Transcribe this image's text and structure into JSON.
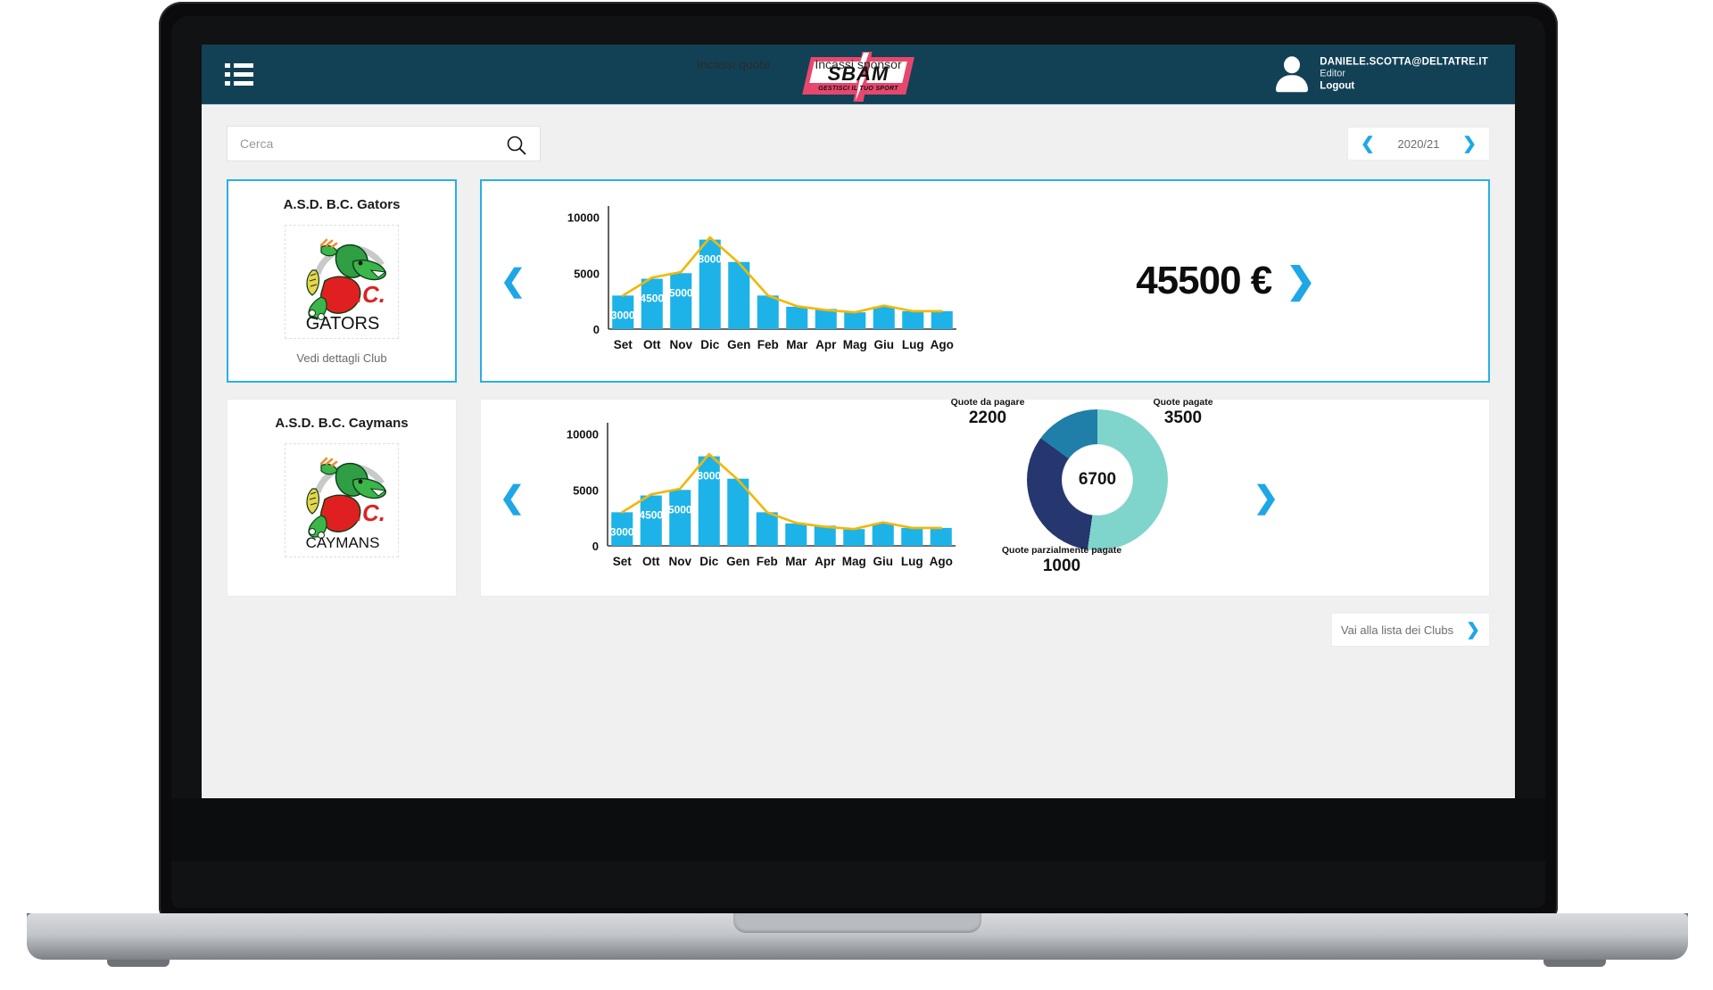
{
  "header": {
    "menu_icon": "hamburger-list-icon",
    "brand": {
      "name": "SBAM",
      "tagline": "GESTISCI IL TUO SPORT"
    },
    "user": {
      "email": "DANIELE.SCOTTA@DELTATRE.IT",
      "role": "Editor",
      "logout": "Logout",
      "avatar_icon": "user-avatar-icon"
    }
  },
  "toolbar": {
    "search_placeholder": "Cerca",
    "search_value": "",
    "search_icon": "search-icon",
    "season": "2020/21",
    "prev_icon": "chevron-left-icon",
    "next_icon": "chevron-right-icon"
  },
  "clubs": [
    {
      "name": "A.S.D. B.C. Gators",
      "link": "Vedi dettagli Club",
      "logo_text": "GATORS",
      "selected": true
    },
    {
      "name": "A.S.D. B.C. Caymans",
      "link": "",
      "logo_text": "CAYMANS",
      "selected": false
    }
  ],
  "sponsor_panel": {
    "title": "Incassi sponsor",
    "total": "45500 €",
    "prev_icon": "chevron-left-icon",
    "next_icon": "chevron-right-icon"
  },
  "quote_panel": {
    "title": "Incassi quote",
    "prev_icon": "chevron-left-icon",
    "next_icon": "chevron-right-icon"
  },
  "footer": {
    "go_clubs": "Vai alla lista dei Clubs",
    "go_icon": "chevron-right-icon"
  },
  "colors": {
    "header_bg": "#124156",
    "accent_blue": "#1ea7e6",
    "bar_blue": "#1db3e8",
    "line_orange": "#f2b705",
    "donut_paid": "#7fd4cc",
    "donut_topay": "#26366e",
    "donut_partial": "#1f7fa8",
    "brand_pink": "#e8476d"
  },
  "chart_data": [
    {
      "id": "incassi-sponsor",
      "type": "bar",
      "title": "Incassi sponsor",
      "categories": [
        "Set",
        "Ott",
        "Nov",
        "Dic",
        "Gen",
        "Feb",
        "Mar",
        "Apr",
        "Mag",
        "Giu",
        "Lug",
        "Ago"
      ],
      "values": [
        3000,
        4500,
        5000,
        8000,
        6000,
        3000,
        2000,
        1800,
        1500,
        2000,
        1600,
        1600
      ],
      "labels": [
        "3000",
        "4500",
        "5000",
        "8000",
        "",
        "",
        "",
        "",
        "",
        "",
        "",
        ""
      ],
      "overlay": {
        "type": "line",
        "name": "trend",
        "values": [
          3000,
          4600,
          5100,
          8200,
          5900,
          3000,
          2050,
          1700,
          1500,
          2100,
          1600,
          1600
        ],
        "color": "#f2b705"
      },
      "xlabel": "",
      "ylabel": "",
      "yticks": [
        0,
        5000,
        10000
      ],
      "ylim": [
        0,
        11000
      ],
      "grid": false,
      "legend": "none",
      "total_label": "45500 €"
    },
    {
      "id": "incassi-quote-bar",
      "type": "bar",
      "title": "Incassi quote",
      "categories": [
        "Set",
        "Ott",
        "Nov",
        "Dic",
        "Gen",
        "Feb",
        "Mar",
        "Apr",
        "Mag",
        "Giu",
        "Lug",
        "Ago"
      ],
      "values": [
        3000,
        4500,
        5000,
        8000,
        6000,
        3000,
        2000,
        1800,
        1500,
        2000,
        1600,
        1600
      ],
      "labels": [
        "3000",
        "4500",
        "5000",
        "8000",
        "",
        "",
        "",
        "",
        "",
        "",
        "",
        ""
      ],
      "overlay": {
        "type": "line",
        "name": "trend",
        "values": [
          3000,
          4600,
          5100,
          8200,
          5900,
          3000,
          2050,
          1700,
          1500,
          2100,
          1600,
          1600
        ],
        "color": "#f2b705"
      },
      "xlabel": "",
      "ylabel": "",
      "yticks": [
        0,
        5000,
        10000
      ],
      "ylim": [
        0,
        11000
      ],
      "grid": false,
      "legend": "none"
    },
    {
      "id": "quote-donut",
      "type": "pie",
      "title": "",
      "center_value": "6700",
      "labels": [
        "Quote pagate",
        "Quote da pagare",
        "Quote parzialmente pagate"
      ],
      "values": [
        3500,
        2200,
        1000
      ],
      "colors": [
        "#7fd4cc",
        "#26366e",
        "#1f7fa8"
      ],
      "legend": "around"
    }
  ]
}
